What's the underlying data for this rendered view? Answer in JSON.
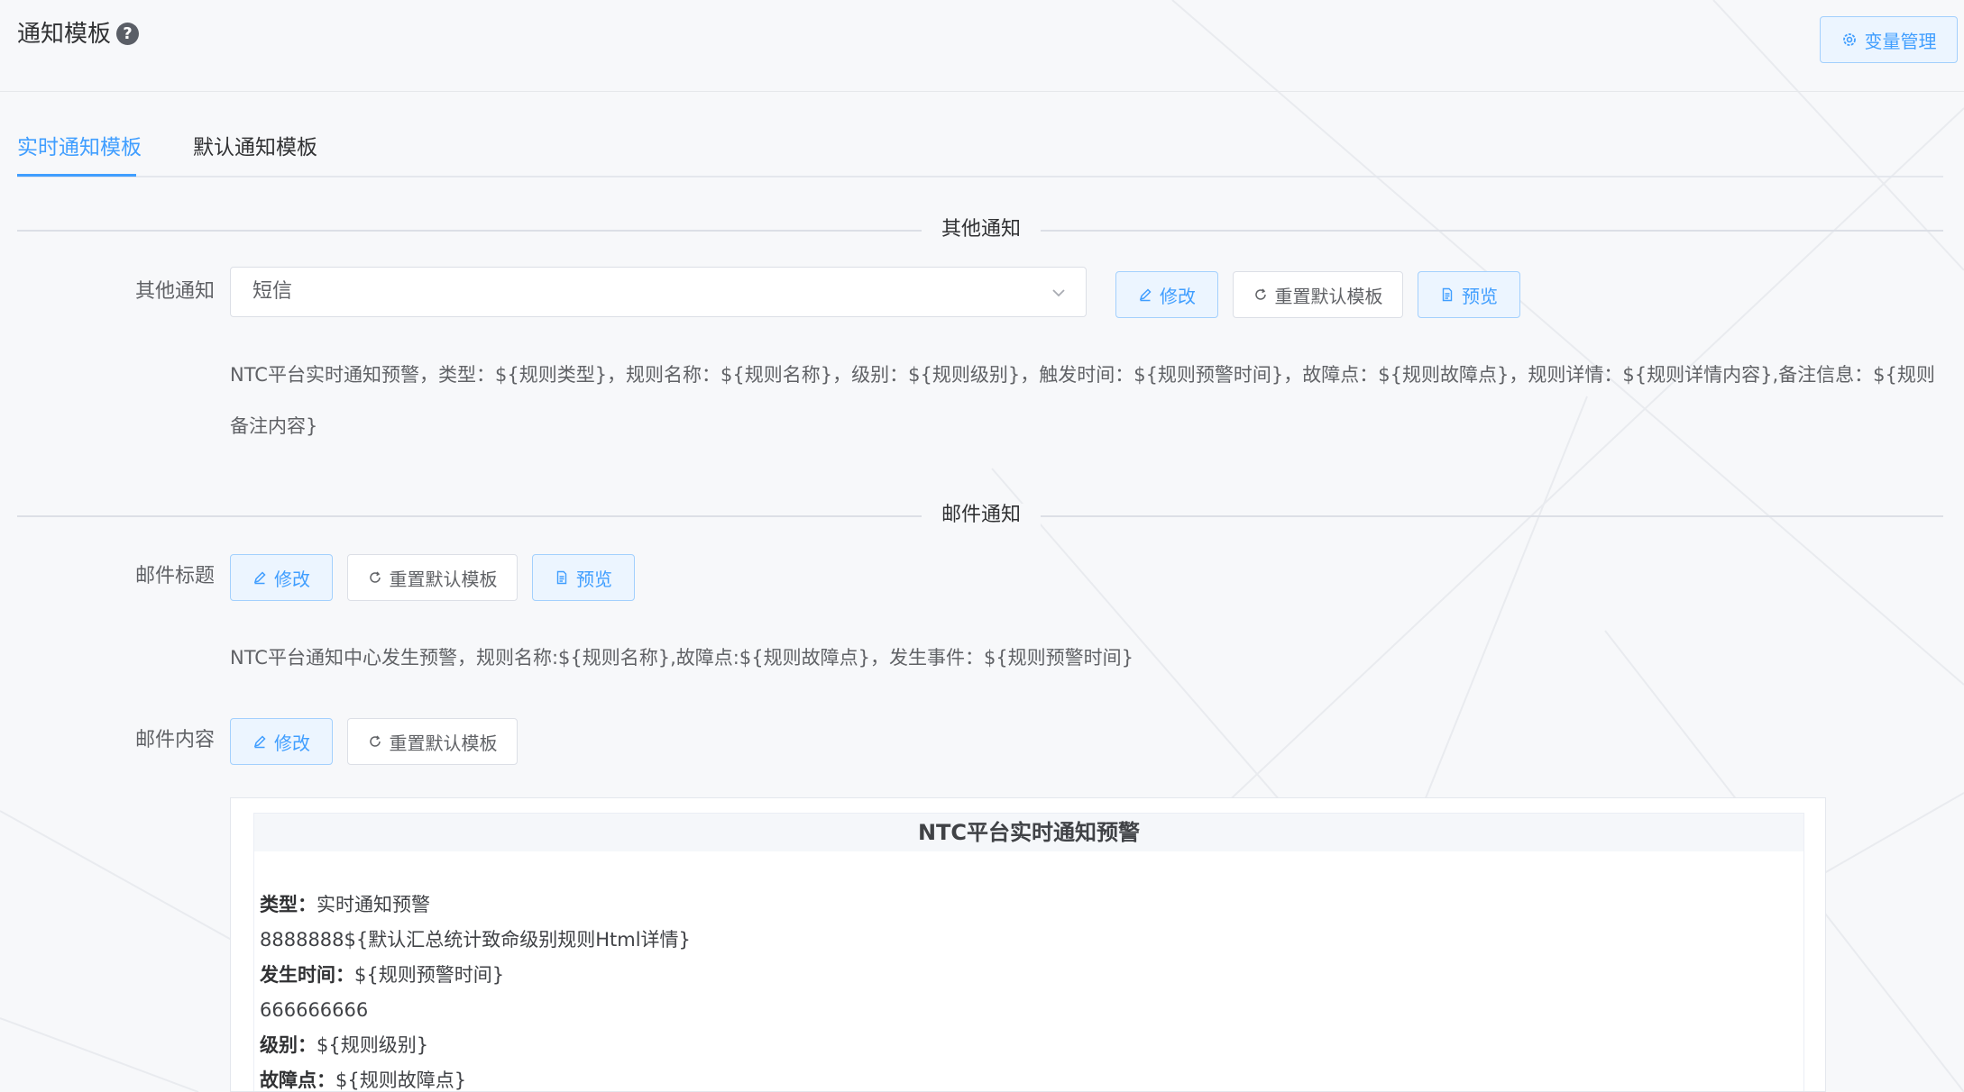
{
  "header": {
    "title": "通知模板",
    "help_icon": "question-circle-icon",
    "variables_button": "变量管理"
  },
  "tabs": [
    {
      "label": "实时通知模板",
      "active": true
    },
    {
      "label": "默认通知模板",
      "active": false
    }
  ],
  "other_section": {
    "divider_title": "其他通知",
    "label": "其他通知",
    "select_value": "短信",
    "edit_button": "修改",
    "reset_button": "重置默认模板",
    "preview_button": "预览",
    "template_text": "NTC平台实时通知预警，类型：${规则类型}，规则名称：${规则名称}，级别：${规则级别}，触发时间：${规则预警时间}，故障点：${规则故障点}，规则详情：${规则详情内容},备注信息：${规则备注内容}"
  },
  "mail_section": {
    "divider_title": "邮件通知",
    "subject_label": "邮件标题",
    "subject_edit_button": "修改",
    "subject_reset_button": "重置默认模板",
    "subject_preview_button": "预览",
    "subject_text": "NTC平台通知中心发生预警，规则名称:${规则名称},故障点:${规则故障点}，发生事件：${规则预警时间}",
    "content_label": "邮件内容",
    "content_edit_button": "修改",
    "content_reset_button": "重置默认模板",
    "content": {
      "heading": "NTC平台实时通知预警",
      "lines": [
        {
          "key": "类型：",
          "value": "实时通知预警"
        },
        {
          "key": "",
          "value": "8888888${默认汇总统计致命级别规则Html详情}"
        },
        {
          "key": "发生时间：",
          "value": "${规则预警时间}"
        },
        {
          "key": "",
          "value": "666666666"
        },
        {
          "key": "级别：",
          "value": "${规则级别}"
        },
        {
          "key": "故障点：",
          "value": "${规则故障点}"
        }
      ]
    }
  },
  "colors": {
    "primary": "#409eff",
    "primary_light_bg": "#ecf5ff",
    "primary_border": "#a3d0fd",
    "text": "#606266",
    "border": "#dcdfe6"
  }
}
